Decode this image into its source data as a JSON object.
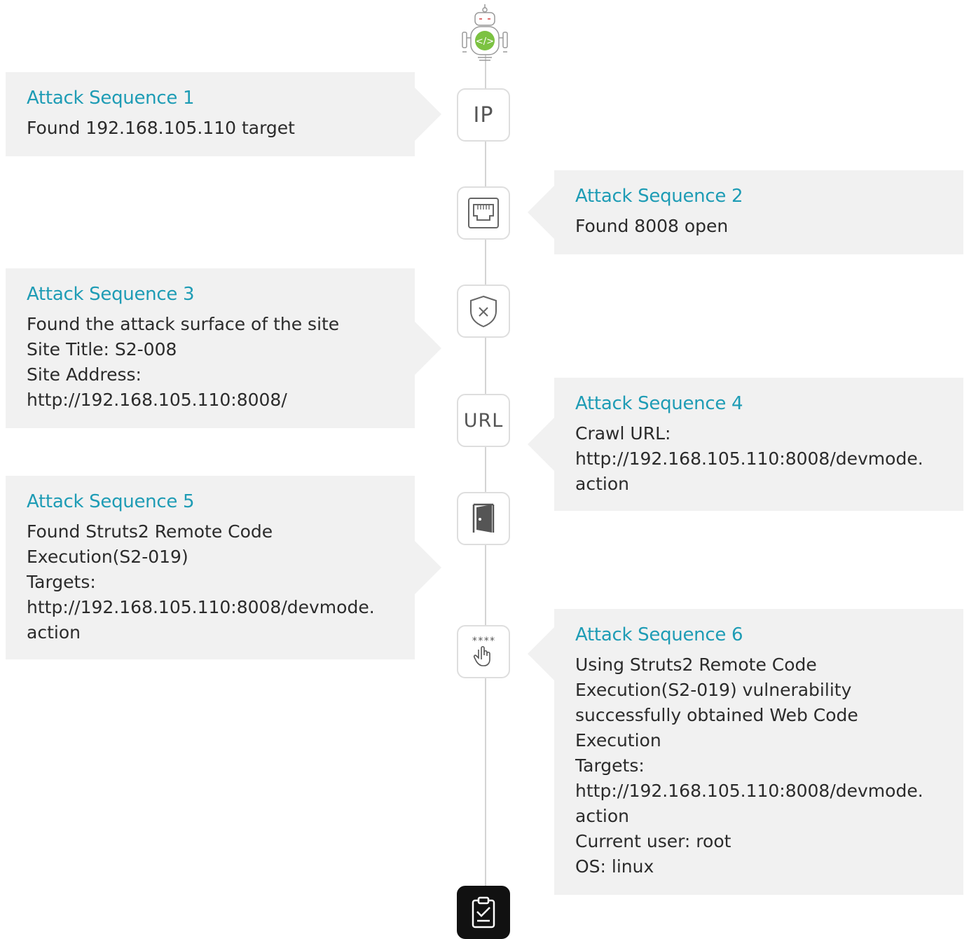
{
  "accent_color": "#1e9cb5",
  "robot": {
    "icon": "robot-icon",
    "badge_icon": "code-icon"
  },
  "nodes": [
    {
      "label": "IP",
      "icon": "ip-icon"
    },
    {
      "label": "",
      "icon": "ethernet-port-icon"
    },
    {
      "label": "",
      "icon": "shield-x-icon"
    },
    {
      "label": "URL",
      "icon": "url-icon"
    },
    {
      "label": "",
      "icon": "door-icon"
    },
    {
      "label": "",
      "icon": "password-click-icon"
    },
    {
      "label": "",
      "icon": "clipboard-check-icon"
    }
  ],
  "sequences": [
    {
      "title": "Attack Sequence 1",
      "lines": [
        "Found 192.168.105.110 target"
      ]
    },
    {
      "title": "Attack Sequence 2",
      "lines": [
        "Found 8008 open"
      ]
    },
    {
      "title": "Attack Sequence 3",
      "lines": [
        "Found the attack surface of the site",
        "Site Title: S2-008",
        "Site Address:",
        "http://192.168.105.110:8008/"
      ]
    },
    {
      "title": "Attack Sequence 4",
      "lines": [
        "Crawl URL:",
        "http://192.168.105.110:8008/devmode.",
        "action"
      ]
    },
    {
      "title": "Attack Sequence 5",
      "lines": [
        "Found Struts2 Remote Code",
        "Execution(S2-019)",
        "Targets:",
        "http://192.168.105.110:8008/devmode.",
        "action"
      ]
    },
    {
      "title": "Attack Sequence 6",
      "lines": [
        "Using Struts2 Remote Code",
        "Execution(S2-019) vulnerability",
        "successfully obtained Web Code",
        "Execution",
        "Targets:",
        "http://192.168.105.110:8008/devmode.",
        "action",
        "Current user: root",
        "OS: linux"
      ]
    }
  ]
}
